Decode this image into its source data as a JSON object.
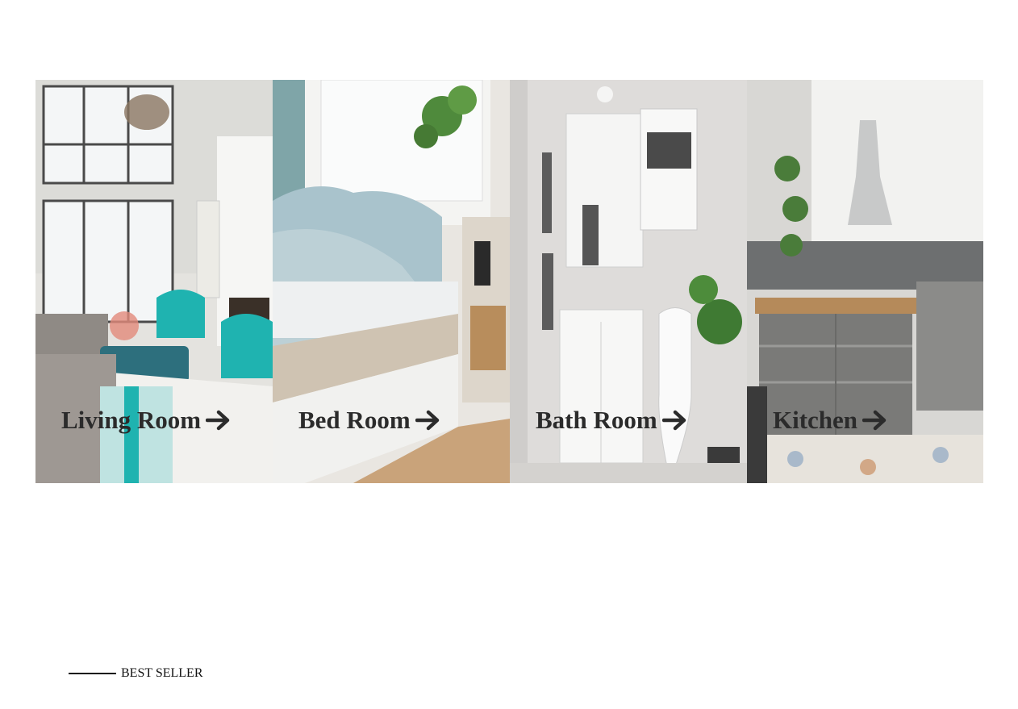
{
  "categories": [
    {
      "label": "Living Room",
      "icon": "arrow-right-icon"
    },
    {
      "label": "Bed Room",
      "icon": "arrow-right-icon"
    },
    {
      "label": "Bath Room",
      "icon": "arrow-right-icon"
    },
    {
      "label": "Kitchen",
      "icon": "arrow-right-icon"
    }
  ],
  "section": {
    "heading": "BEST SELLER"
  },
  "colors": {
    "label_text": "#2b2b2b",
    "page_background": "#ffffff",
    "living_accent": "#1fb3b0",
    "bedroom_accent": "#a9c3cc",
    "kitchen_accent": "#7a7a78"
  }
}
